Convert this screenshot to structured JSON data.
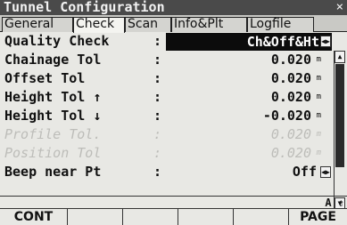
{
  "window": {
    "title": "Tunnel Configuration",
    "close_glyph": "×"
  },
  "tabs": [
    {
      "label": "General",
      "active": false
    },
    {
      "label": "Check",
      "active": true
    },
    {
      "label": "Scan",
      "active": false
    },
    {
      "label": "Info&Plt",
      "active": false
    },
    {
      "label": "Logfile",
      "active": false
    }
  ],
  "rows": [
    {
      "label": "Quality Check",
      "value": "Ch&Off&Ht",
      "unit": "",
      "enabled": true,
      "selected": true
    },
    {
      "label": "Chainage Tol",
      "value": "0.020",
      "unit": "m",
      "enabled": true
    },
    {
      "label": "Offset Tol",
      "value": "0.020",
      "unit": "m",
      "enabled": true
    },
    {
      "label": "Height Tol ↑",
      "value": "0.020",
      "unit": "m",
      "enabled": true
    },
    {
      "label": "Height Tol ↓",
      "value": "-0.020",
      "unit": "m",
      "enabled": true
    },
    {
      "label": "Profile Tol.",
      "value": "0.020",
      "unit": "m",
      "enabled": false
    },
    {
      "label": "Position Tol",
      "value": "0.020",
      "unit": "m",
      "enabled": false
    },
    {
      "label": "Beep near Pt",
      "value": "Off",
      "unit": "",
      "enabled": true
    }
  ],
  "colon": ":",
  "list_arrows": "◀▶",
  "scroll": {
    "up": "▲",
    "down": "▼"
  },
  "status_indicator": "A ⇧",
  "softkeys": [
    "CONT",
    "",
    "",
    "",
    "",
    "PAGE"
  ]
}
